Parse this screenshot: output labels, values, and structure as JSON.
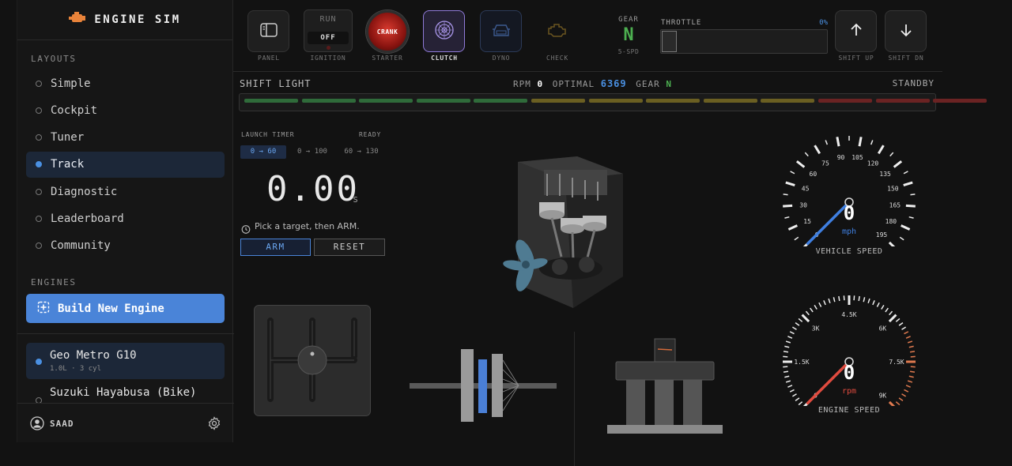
{
  "sidebar": {
    "brand": "ENGINE SIM",
    "layouts_label": "LAYOUTS",
    "layouts": [
      {
        "label": "Simple",
        "active": false
      },
      {
        "label": "Cockpit",
        "active": false
      },
      {
        "label": "Tuner",
        "active": false
      },
      {
        "label": "Track",
        "active": true
      },
      {
        "label": "Diagnostic",
        "active": false
      },
      {
        "label": "Leaderboard",
        "active": false
      },
      {
        "label": "Community",
        "active": false
      }
    ],
    "engines_label": "ENGINES",
    "build_label": "Build New Engine",
    "engines": [
      {
        "name": "Geo Metro G10",
        "sub": "1.0L · 3 cyl",
        "active": true
      },
      {
        "name": "Suzuki Hayabusa (Bike)",
        "sub": "",
        "active": false
      }
    ],
    "user": "SAAD"
  },
  "toolbar": {
    "panel": "PANEL",
    "ignition": "IGNITION",
    "ign_run": "RUN",
    "ign_off": "OFF",
    "starter": "STARTER",
    "crank": "CRANK",
    "clutch": "CLUTCH",
    "dyno": "DYNO",
    "check": "CHECK",
    "gear_label": "GEAR",
    "gear_value": "N",
    "gear_sub": "5-SPD",
    "throttle_label": "THROTTLE",
    "throttle_value": "0%",
    "throttle_fraction": 0,
    "shift_up": "SHIFT UP",
    "shift_dn": "SHIFT DN"
  },
  "shift_light": {
    "title": "SHIFT LIGHT",
    "rpm_label": "RPM",
    "rpm": "0",
    "optimal_label": "OPTIMAL",
    "optimal": "6369",
    "gear_label": "GEAR",
    "gear": "N",
    "status": "STANDBY",
    "leds": [
      "#2f6b3a",
      "#2f6b3a",
      "#2f6b3a",
      "#2f6b3a",
      "#2f6b3a",
      "#6b5f22",
      "#6b5f22",
      "#6b5f22",
      "#6b5f22",
      "#6b5f22",
      "#6b2323",
      "#6b2323",
      "#6b2323"
    ]
  },
  "launch": {
    "title": "LAUNCH TIMER",
    "status": "READY",
    "tabs": [
      "0 → 60",
      "0 → 100",
      "60 → 130"
    ],
    "time": "0.00",
    "unit": "s",
    "hint": "Pick a target, then ARM.",
    "arm": "ARM",
    "reset": "RESET"
  },
  "speed_gauge": {
    "label": "VEHICLE SPEED",
    "value": "0",
    "unit": "mph",
    "ticks": [
      "0",
      "15",
      "30",
      "45",
      "60",
      "75",
      "90",
      "105",
      "120",
      "135",
      "150",
      "165",
      "180",
      "195"
    ],
    "needle_color": "#3f7fe0"
  },
  "rpm_gauge": {
    "label": "ENGINE SPEED",
    "value": "0",
    "unit": "rpm",
    "ticks": [
      "0",
      "1.5K",
      "3K",
      "4.5K",
      "6K",
      "7.5K",
      "9K"
    ],
    "needle_color": "#e04b3f",
    "redline_color": "#e07a4f"
  }
}
